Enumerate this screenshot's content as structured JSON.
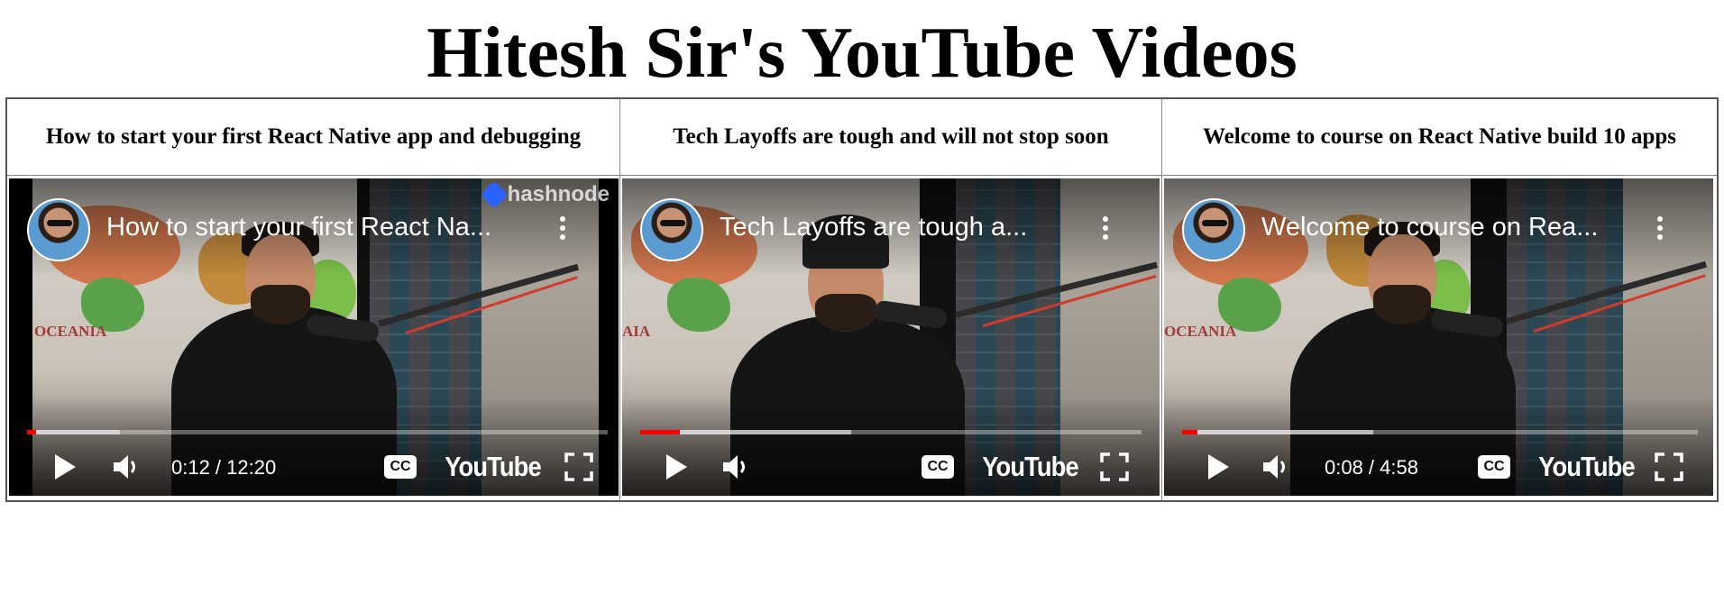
{
  "page": {
    "title": "Hitesh Sir's YouTube Videos"
  },
  "videos": [
    {
      "header": "How to start your first React Native app and debugging",
      "overlay_title": "How to start your first React Na...",
      "time": "0:12 / 12:20",
      "progress": 0.016,
      "buffered": 0.16,
      "watermark": "hashnode",
      "youtube_logo": "YouTube",
      "cc_label": "CC"
    },
    {
      "header": "Tech Layoffs are tough and will not stop soon",
      "overlay_title": "Tech Layoffs are tough a...",
      "time": "",
      "progress": 0.08,
      "buffered": 0.42,
      "watermark": "",
      "youtube_logo": "YouTube",
      "cc_label": "CC"
    },
    {
      "header": "Welcome to course on React Native build 10 apps",
      "overlay_title": "Welcome to course on Rea...",
      "time": "0:08 / 4:58",
      "progress": 0.03,
      "buffered": 0.37,
      "watermark": "",
      "youtube_logo": "YouTube",
      "cc_label": "CC"
    }
  ],
  "icons": {
    "play": "play-icon",
    "volume": "volume-icon",
    "captions": "captions-icon",
    "fullscreen": "fullscreen-icon",
    "more": "more-vert-icon",
    "avatar": "channel-avatar"
  },
  "colors": {
    "progress": "#ff0000",
    "watermark_brand": "#2962ff"
  }
}
